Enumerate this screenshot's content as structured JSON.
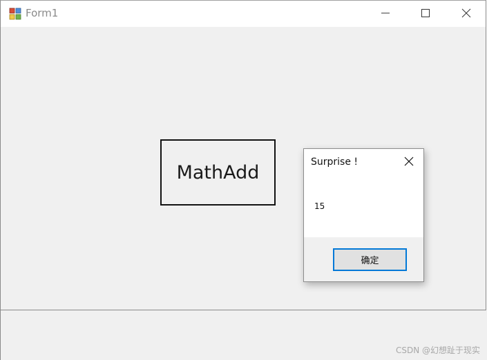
{
  "window": {
    "title": "Form1",
    "icon": "winforms-app-icon",
    "caption_buttons": [
      "minimize-icon",
      "maximize-icon",
      "close-icon"
    ]
  },
  "main": {
    "button_label": "MathAdd"
  },
  "message_box": {
    "title": "Surprise !",
    "text": "15",
    "ok_label": "确定",
    "close_icon": "close-icon"
  },
  "watermark": {
    "text": "CSDN @幻想趾于现实"
  },
  "colors": {
    "window_bg": "#f0f0f0",
    "titlebar_bg": "#ffffff",
    "title_text": "#8a8a8a",
    "button_border": "#111111",
    "dialog_focus_border": "#0078d7",
    "dialog_footer_bg": "#f0f0f0"
  }
}
